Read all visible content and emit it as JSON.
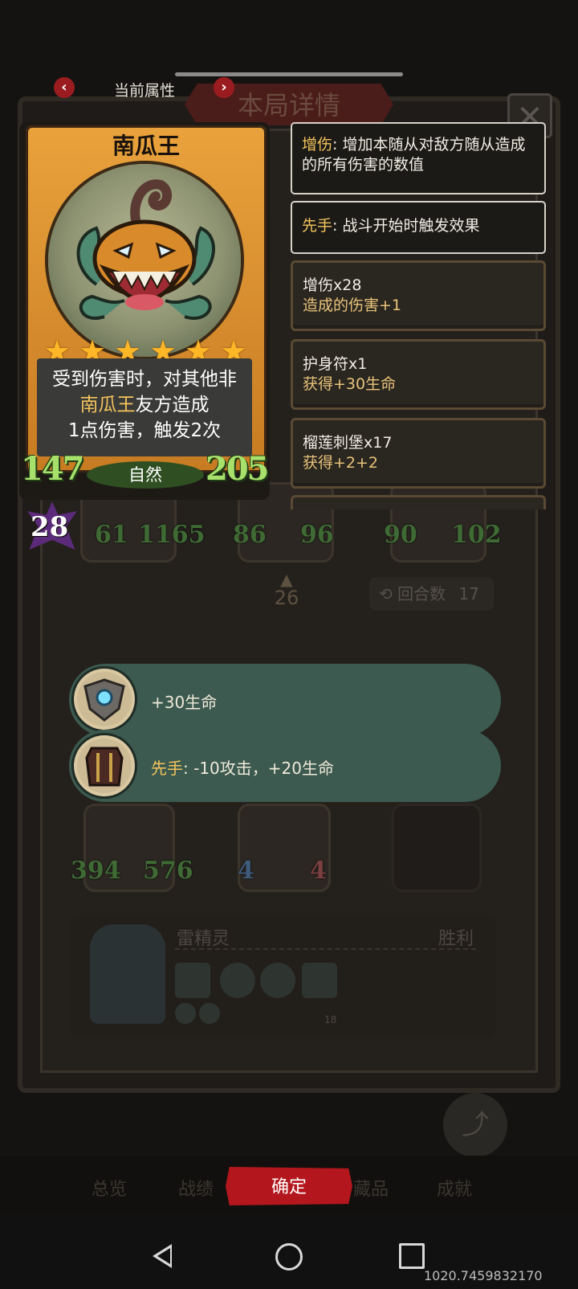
{
  "header": {
    "prev_icon": "chevron-left-icon",
    "next_icon": "chevron-right-icon",
    "current_attr_label": "当前属性",
    "background_title": "本局详情"
  },
  "card": {
    "name": "南瓜王",
    "stars": 6,
    "desc_line1": "受到伤害时，对其他非",
    "desc_highlight": "南瓜王",
    "desc_line2_rest": "友方造成",
    "desc_line3": "1点伤害，触发2次",
    "attack": "147",
    "health": "205",
    "tribe": "自然",
    "level": "28"
  },
  "info_panels": [
    {
      "keyword": "增伤",
      "text": ": 增加本随从对敌方随从造成的所有伤害的数值"
    },
    {
      "keyword": "先手",
      "text": ": 战斗开始时触发效果"
    }
  ],
  "items": [
    {
      "name": "增伤x28",
      "effect": "造成的伤害+1"
    },
    {
      "name": "护身符x1",
      "effect": "获得+30生命"
    },
    {
      "name": "榴莲刺堡x17",
      "effect": "获得+2+2"
    }
  ],
  "banners": [
    {
      "icon": "shield-crest-icon",
      "text": "+30生命"
    },
    {
      "icon": "armor-icon",
      "keyword": "先手",
      "text": ": -10攻击，+20生命"
    }
  ],
  "background": {
    "row1_stats": [
      "61",
      "1165",
      "86",
      "96",
      "90",
      "102"
    ],
    "center_badge": "26",
    "round_label": "回合数",
    "round_value": "17",
    "row2_stats": [
      "394",
      "576",
      "4",
      "4"
    ],
    "player_name": "雷精灵",
    "player_result": "胜利",
    "item_count": "18"
  },
  "bottom_tabs": {
    "tab1": "总览",
    "tab2": "战绩",
    "confirm": "确定",
    "tab4": "藏品",
    "tab5": "成就",
    "share": "分享"
  },
  "overlay": {
    "coords": "1020.7459832170"
  }
}
